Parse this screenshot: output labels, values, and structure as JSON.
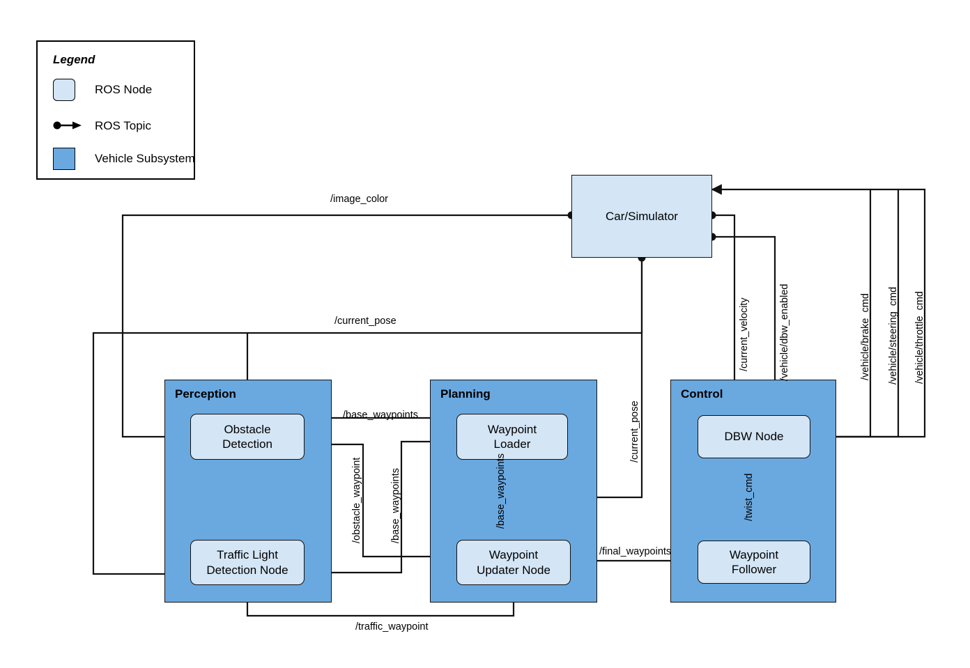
{
  "legend": {
    "title": "Legend",
    "items": [
      {
        "key": "ros-node",
        "label": "ROS Node",
        "swatch": "node"
      },
      {
        "key": "ros-topic",
        "label": "ROS Topic",
        "swatch": "topic"
      },
      {
        "key": "vehicle-subsystem",
        "label": "Vehicle Subsystem",
        "swatch": "subsystem"
      }
    ]
  },
  "colors": {
    "node_fill": "#d4e5f5",
    "subsystem_fill": "#6aa8e0",
    "stroke": "#111111",
    "background": "#ffffff"
  },
  "subsystems": [
    {
      "key": "perception",
      "title": "Perception"
    },
    {
      "key": "planning",
      "title": "Planning"
    },
    {
      "key": "control",
      "title": "Control"
    }
  ],
  "nodes": [
    {
      "key": "car-simulator",
      "label": "Car/Simulator",
      "subsystem": null
    },
    {
      "key": "obstacle-detection",
      "label": "Obstacle\nDetection",
      "subsystem": "perception"
    },
    {
      "key": "traffic-light-detection",
      "label": "Traffic Light\nDetection Node",
      "subsystem": "perception"
    },
    {
      "key": "waypoint-loader",
      "label": "Waypoint\nLoader",
      "subsystem": "planning"
    },
    {
      "key": "waypoint-updater",
      "label": "Waypoint\nUpdater Node",
      "subsystem": "planning"
    },
    {
      "key": "dbw-node",
      "label": "DBW Node",
      "subsystem": "control"
    },
    {
      "key": "waypoint-follower",
      "label": "Waypoint\nFollower",
      "subsystem": "control"
    }
  ],
  "topics": [
    {
      "key": "image-color",
      "label": "/image_color",
      "orient": "h",
      "from": "car-simulator",
      "to": "obstacle-detection"
    },
    {
      "key": "current-pose-left",
      "label": "/current_pose",
      "orient": "h",
      "from": "car-simulator",
      "to": "traffic-light-detection"
    },
    {
      "key": "base-waypoints-top",
      "label": "/base_waypoints",
      "orient": "h",
      "from": "waypoint-loader",
      "to": "obstacle-detection"
    },
    {
      "key": "obstacle-waypoint",
      "label": "/obstacle_waypoint",
      "orient": "v",
      "from": "obstacle-detection",
      "to": "waypoint-updater"
    },
    {
      "key": "base-waypoints-mid",
      "label": "/base_waypoints",
      "orient": "v",
      "from": "waypoint-loader",
      "to": "traffic-light-detection"
    },
    {
      "key": "base-waypoints-down",
      "label": "/base_waypoints",
      "orient": "v",
      "from": "waypoint-loader",
      "to": "waypoint-updater"
    },
    {
      "key": "current-pose-right",
      "label": "/current_pose",
      "orient": "v",
      "from": "car-simulator",
      "to": "waypoint-updater"
    },
    {
      "key": "final-waypoints",
      "label": "/final_waypoints",
      "orient": "h",
      "from": "waypoint-updater",
      "to": "waypoint-follower"
    },
    {
      "key": "traffic-waypoint",
      "label": "/traffic_waypoint",
      "orient": "h",
      "from": "traffic-light-detection",
      "to": "waypoint-updater"
    },
    {
      "key": "twist-cmd",
      "label": "/twist_cmd",
      "orient": "v",
      "from": "waypoint-follower",
      "to": "dbw-node"
    },
    {
      "key": "current-velocity",
      "label": "/current_velocity",
      "orient": "v",
      "from": "car-simulator",
      "to": "dbw-node"
    },
    {
      "key": "vehicle-dbw-enabled",
      "label": "/vehicle/dbw_enabled",
      "orient": "v",
      "from": "car-simulator",
      "to": "dbw-node"
    },
    {
      "key": "vehicle-brake-cmd",
      "label": "/vehicle/brake_cmd",
      "orient": "v",
      "from": "dbw-node",
      "to": "car-simulator"
    },
    {
      "key": "vehicle-steering-cmd",
      "label": "/vehicle/steering_cmd",
      "orient": "v",
      "from": "dbw-node",
      "to": "car-simulator"
    },
    {
      "key": "vehicle-throttle-cmd",
      "label": "/vehicle/throttle_cmd",
      "orient": "v",
      "from": "dbw-node",
      "to": "car-simulator"
    }
  ]
}
